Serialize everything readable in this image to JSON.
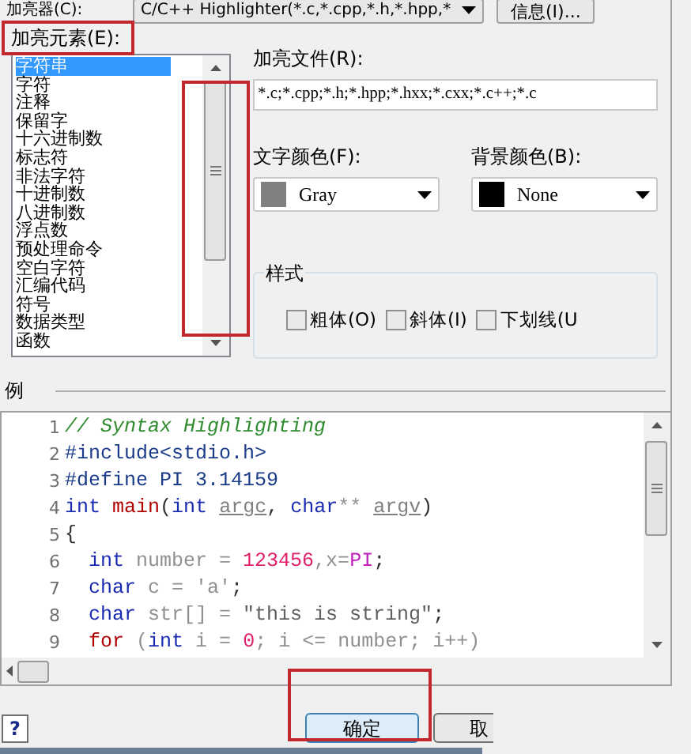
{
  "highlighter": {
    "label": "加亮器(C):",
    "value": "C/C++ Highlighter(*.c,*.cpp,*.h,*.hpp,*",
    "info_button": "信息(I)..."
  },
  "elements": {
    "label": "加亮元素(E):",
    "items": [
      {
        "label": "字符串",
        "selected": true
      },
      {
        "label": "字符",
        "selected": false
      },
      {
        "label": "注释",
        "selected": false
      },
      {
        "label": "保留字",
        "selected": false
      },
      {
        "label": "十六进制数",
        "selected": false
      },
      {
        "label": "标志符",
        "selected": false
      },
      {
        "label": "非法字符",
        "selected": false
      },
      {
        "label": "十进制数",
        "selected": false
      },
      {
        "label": "八进制数",
        "selected": false
      },
      {
        "label": "浮点数",
        "selected": false
      },
      {
        "label": "预处理命令",
        "selected": false
      },
      {
        "label": "空白字符",
        "selected": false
      },
      {
        "label": "汇编代码",
        "selected": false
      },
      {
        "label": "符号",
        "selected": false
      },
      {
        "label": "数据类型",
        "selected": false
      },
      {
        "label": "函数",
        "selected": false
      }
    ]
  },
  "files": {
    "label": "加亮文件(R):",
    "value": "*.c;*.cpp;*.h;*.hpp;*.hxx;*.cxx;*.c++;*.c"
  },
  "text_color": {
    "label": "文字颜色(F):",
    "value": "Gray",
    "color": "#808080"
  },
  "background_color": {
    "label": "背景颜色(B):",
    "value": "None",
    "color": "#000000"
  },
  "style": {
    "title": "样式",
    "options": [
      {
        "label": "粗体(O)",
        "checked": false
      },
      {
        "label": "斜体(I)",
        "checked": false
      },
      {
        "label": "下划线(U",
        "checked": false
      }
    ]
  },
  "sample": {
    "title": "例",
    "lines": [
      {
        "number": "1",
        "indent": false,
        "tokens": [
          {
            "text": "// Syntax Highlighting",
            "kind": "comment"
          }
        ]
      },
      {
        "number": "2",
        "indent": false,
        "tokens": [
          {
            "text": "#include<stdio.h>",
            "kind": "preprocessor"
          }
        ]
      },
      {
        "number": "3",
        "indent": false,
        "tokens": [
          {
            "text": "#define PI 3.14159",
            "kind": "preprocessor"
          }
        ]
      },
      {
        "number": "4",
        "indent": false,
        "tokens": [
          {
            "text": "int ",
            "kind": "keyword"
          },
          {
            "text": "main",
            "kind": "function"
          },
          {
            "text": "(",
            "kind": "punct"
          },
          {
            "text": "int ",
            "kind": "keyword"
          },
          {
            "text": "argc",
            "kind": "param"
          },
          {
            "text": ", ",
            "kind": "punct"
          },
          {
            "text": "char",
            "kind": "keyword"
          },
          {
            "text": "** ",
            "kind": "plain"
          },
          {
            "text": "argv",
            "kind": "param"
          },
          {
            "text": ")",
            "kind": "punct"
          }
        ]
      },
      {
        "number": "5",
        "indent": false,
        "tokens": [
          {
            "text": "{",
            "kind": "punct"
          }
        ]
      },
      {
        "number": "6",
        "indent": true,
        "tokens": [
          {
            "text": "int",
            "kind": "keyword"
          },
          {
            "text": " number = ",
            "kind": "plain"
          },
          {
            "text": "123456",
            "kind": "number"
          },
          {
            "text": ",x=",
            "kind": "plain"
          },
          {
            "text": "PI",
            "kind": "macro"
          },
          {
            "text": ";",
            "kind": "punct"
          }
        ]
      },
      {
        "number": "7",
        "indent": true,
        "tokens": [
          {
            "text": "char",
            "kind": "keyword"
          },
          {
            "text": " c = ",
            "kind": "plain"
          },
          {
            "text": "'a'",
            "kind": "plain"
          },
          {
            "text": ";",
            "kind": "punct"
          }
        ]
      },
      {
        "number": "8",
        "indent": true,
        "tokens": [
          {
            "text": "char",
            "kind": "keyword"
          },
          {
            "text": " str[] = ",
            "kind": "plain"
          },
          {
            "text": "\"this is string\"",
            "kind": "string"
          },
          {
            "text": ";",
            "kind": "punct"
          }
        ]
      },
      {
        "number": "9",
        "indent": true,
        "tokens": [
          {
            "text": "for",
            "kind": "function"
          },
          {
            "text": " (",
            "kind": "plain"
          },
          {
            "text": "int",
            "kind": "keyword"
          },
          {
            "text": " i = ",
            "kind": "plain"
          },
          {
            "text": "0",
            "kind": "number"
          },
          {
            "text": "; i <= number; i++)",
            "kind": "plain"
          }
        ]
      }
    ]
  },
  "buttons": {
    "help": "?",
    "ok": "确定",
    "cancel": "取"
  }
}
